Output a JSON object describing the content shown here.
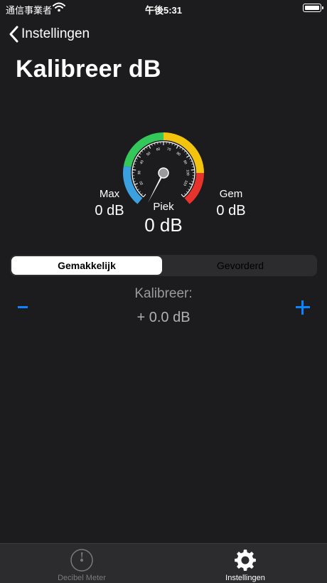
{
  "status_bar": {
    "carrier": "通信事業者",
    "time": "午後5:31"
  },
  "nav": {
    "back_label": "Instellingen"
  },
  "title": "Kalibreer dB",
  "gauge": {
    "ticks": [
      "20",
      "30",
      "40",
      "50",
      "60",
      "70",
      "80",
      "90",
      "100",
      "110"
    ],
    "colors": {
      "blue": "#3aa0e0",
      "green": "#34c759",
      "yellow": "#f2c40f",
      "red": "#e8322c"
    }
  },
  "stats": {
    "max": {
      "label": "Max",
      "value": "0 dB"
    },
    "peak": {
      "label": "Piek",
      "value": "0 dB"
    },
    "avg": {
      "label": "Gem",
      "value": "0 dB"
    }
  },
  "segmented": {
    "easy": "Gemakkelijk",
    "advanced": "Gevorderd",
    "selected": "Gemakkelijk"
  },
  "calibrate": {
    "label": "Kalibreer:",
    "value": "+ 0.0 dB",
    "minus": "-",
    "plus": "+"
  },
  "tabs": [
    {
      "label": "Decibel Meter",
      "icon": "gauge-icon",
      "selected": false
    },
    {
      "label": "Instellingen",
      "icon": "gear-icon",
      "selected": true
    }
  ],
  "accent": "#0a84ff"
}
